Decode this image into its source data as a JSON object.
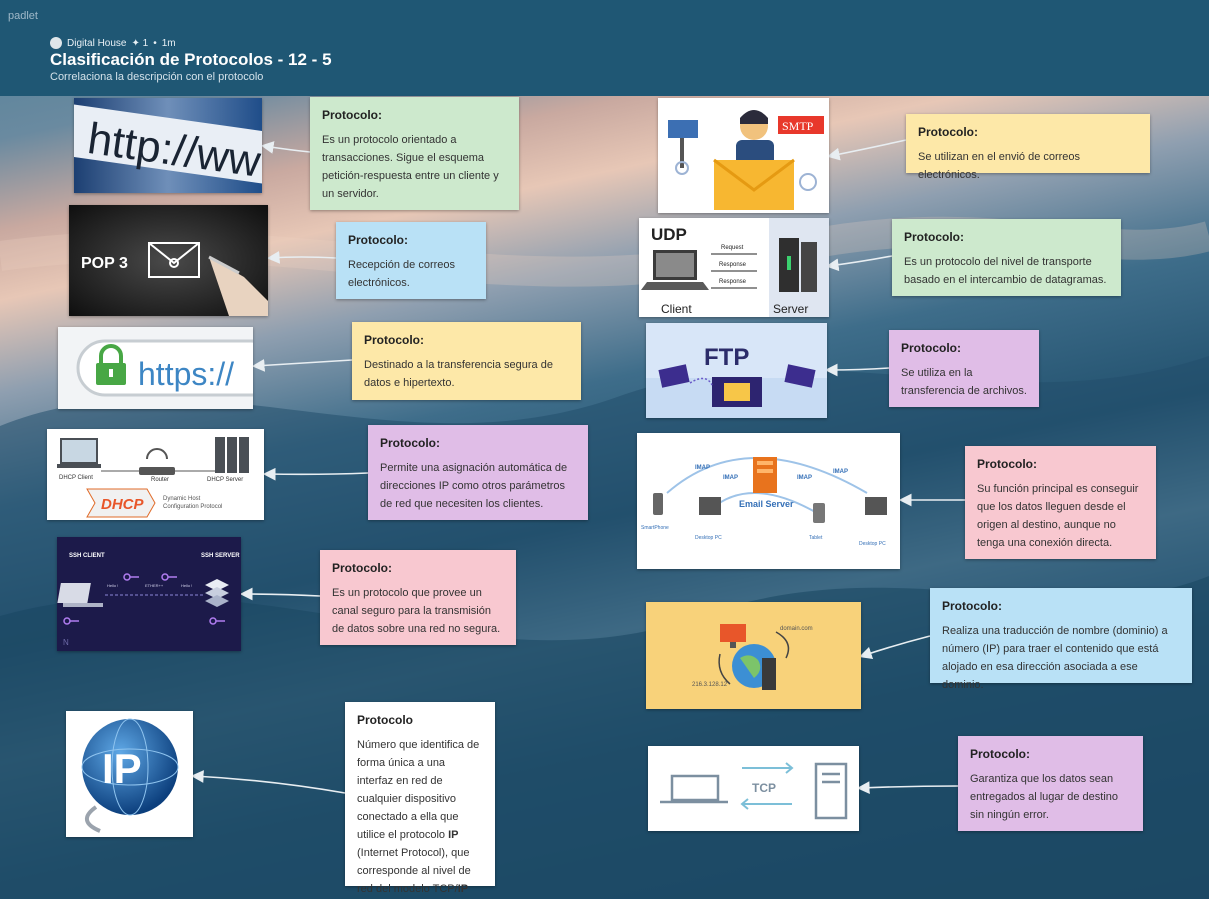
{
  "app": {
    "brand": "padlet"
  },
  "header": {
    "author": "Digital House",
    "plus": "✦ 1",
    "dot": "•",
    "time": "1m",
    "title": "Clasificación de Protocolos - 12 - 5",
    "subtitle": "Correlaciona la descripción con el protocolo"
  },
  "images": {
    "http": {
      "label": "http://ww"
    },
    "pop3": {
      "label": "POP 3"
    },
    "https": {
      "label": "https://"
    },
    "dhcp": {
      "logo": "DHCP",
      "client": "DHCP Client",
      "router": "Router",
      "server": "DHCP Server",
      "desc1": "Dynamic Host",
      "desc2": "Configuration Protocol"
    },
    "ssh": {
      "client": "SSH CLIENT",
      "server": "SSH SERVER",
      "hello1": "Hello !",
      "hello2": "Hello !",
      "ether": "ETHER++"
    },
    "ip": {
      "label": "IP"
    },
    "smtp": {
      "label": "SMTP"
    },
    "udp": {
      "label": "UDP",
      "request": "Request",
      "response1": "Response",
      "response2": "Response",
      "client": "Client",
      "server": "Server"
    },
    "ftp": {
      "label": "FTP"
    },
    "imap": {
      "server": "Email Server",
      "imap1": "IMAP",
      "imap2": "IMAP",
      "imap3": "IMAP",
      "imap4": "IMAP",
      "smartphone": "SmartPhone",
      "desktop1": "Desktop PC",
      "tablet": "Tablet",
      "desktop2": "Desktop PC"
    },
    "dns": {
      "domain": "domain.com",
      "ip": "216.3.128.12"
    },
    "tcp": {
      "label": "TCP"
    }
  },
  "cards": {
    "c1": {
      "heading": "Protocolo:",
      "text": "Es un protocolo orientado a transacciones. Sigue el esquema petición-respuesta entre un cliente y un servidor."
    },
    "c2": {
      "heading": "Protocolo:",
      "text": "Recepción de correos electrónicos."
    },
    "c3": {
      "heading": "Protocolo:",
      "text": "Destinado a la transferencia segura de datos e hipertexto."
    },
    "c4": {
      "heading": "Protocolo:",
      "text": "Permite una asignación automática de direcciones IP como otros parámetros de red que necesiten los clientes."
    },
    "c5": {
      "heading": "Protocolo:",
      "text": "Es un protocolo que provee un canal seguro para la transmisión de datos sobre una red no segura."
    },
    "c6": {
      "heading": "Protocolo",
      "text_a": "Número que identifica de forma única a una interfaz en red de cualquier dispositivo conectado a ella que utilice el protocolo ",
      "bold_a": "IP",
      "text_b": " (Internet Protocol), que corresponde al nivel de red del modelo TCP/",
      "bold_b": "IP"
    },
    "c7": {
      "heading": "Protocolo:",
      "text": "Se utilizan en el envió de correos electrónicos."
    },
    "c8": {
      "heading": "Protocolo:",
      "text": "Es un protocolo del nivel de transporte basado en el intercambio de datagramas."
    },
    "c9": {
      "heading": "Protocolo:",
      "text": "Se utiliza en la transferencia de archivos."
    },
    "c10": {
      "heading": "Protocolo:",
      "text": "Su función principal es conseguir que los datos lleguen desde el origen al destino, aunque no tenga una conexión directa."
    },
    "c11": {
      "heading": "Protocolo:",
      "text": "Realiza una traducción de nombre (dominio) a número (IP) para traer el contenido que está alojado en esa dirección asociada a ese dominio."
    },
    "c12": {
      "heading": "Protocolo:",
      "text": "Garantiza que los datos sean entregados al lugar de destino sin ningún error."
    }
  },
  "colors": {
    "header": "#1f5774",
    "green": "#cde9cd",
    "blue": "#b9e1f6",
    "yellow": "#fde8a8",
    "purple": "#e0bde7",
    "pink": "#f8c8d0"
  }
}
